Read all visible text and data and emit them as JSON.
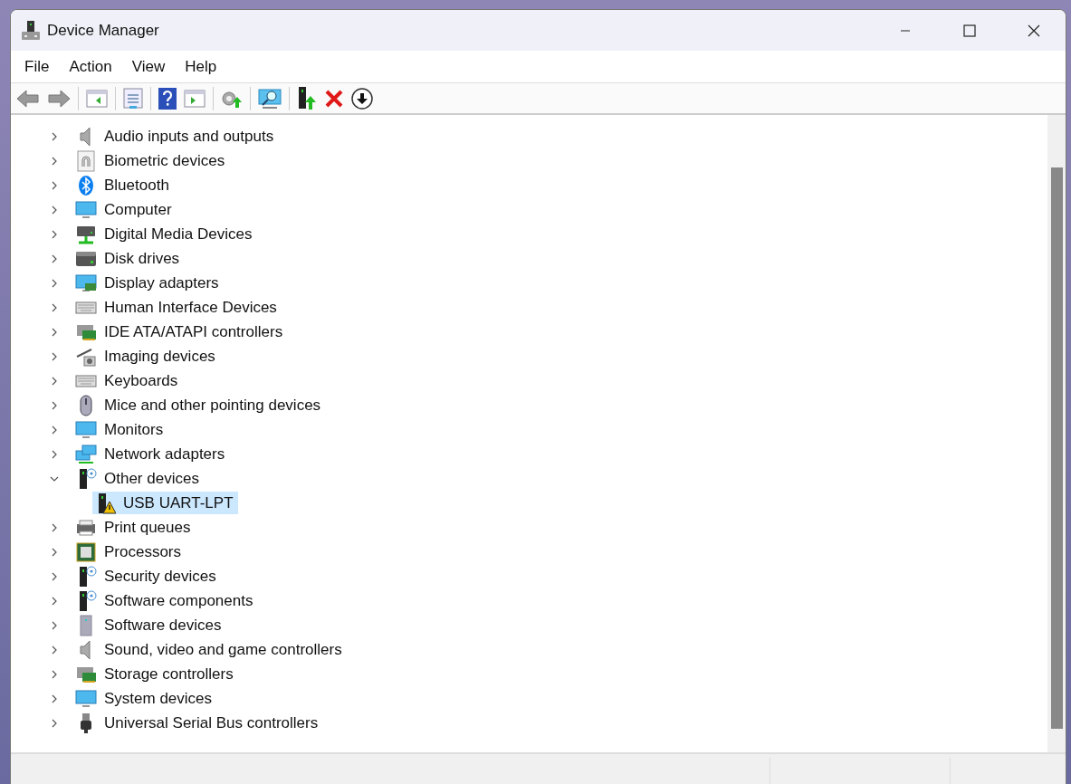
{
  "window": {
    "title": "Device Manager"
  },
  "menu": [
    "File",
    "Action",
    "View",
    "Help"
  ],
  "tree": [
    {
      "label": "Audio inputs and outputs",
      "expanded": false
    },
    {
      "label": "Biometric devices",
      "expanded": false
    },
    {
      "label": "Bluetooth",
      "expanded": false
    },
    {
      "label": "Computer",
      "expanded": false
    },
    {
      "label": "Digital Media Devices",
      "expanded": false
    },
    {
      "label": "Disk drives",
      "expanded": false
    },
    {
      "label": "Display adapters",
      "expanded": false
    },
    {
      "label": "Human Interface Devices",
      "expanded": false
    },
    {
      "label": "IDE ATA/ATAPI controllers",
      "expanded": false
    },
    {
      "label": "Imaging devices",
      "expanded": false
    },
    {
      "label": "Keyboards",
      "expanded": false
    },
    {
      "label": "Mice and other pointing devices",
      "expanded": false
    },
    {
      "label": "Monitors",
      "expanded": false
    },
    {
      "label": "Network adapters",
      "expanded": false
    },
    {
      "label": "Other devices",
      "expanded": true,
      "children": [
        {
          "label": "USB UART-LPT",
          "selected": true,
          "warning": true
        }
      ]
    },
    {
      "label": "Print queues",
      "expanded": false
    },
    {
      "label": "Processors",
      "expanded": false
    },
    {
      "label": "Security devices",
      "expanded": false
    },
    {
      "label": "Software components",
      "expanded": false
    },
    {
      "label": "Software devices",
      "expanded": false
    },
    {
      "label": "Sound, video and game controllers",
      "expanded": false
    },
    {
      "label": "Storage controllers",
      "expanded": false
    },
    {
      "label": "System devices",
      "expanded": false
    },
    {
      "label": "Universal Serial Bus controllers",
      "expanded": false
    }
  ]
}
